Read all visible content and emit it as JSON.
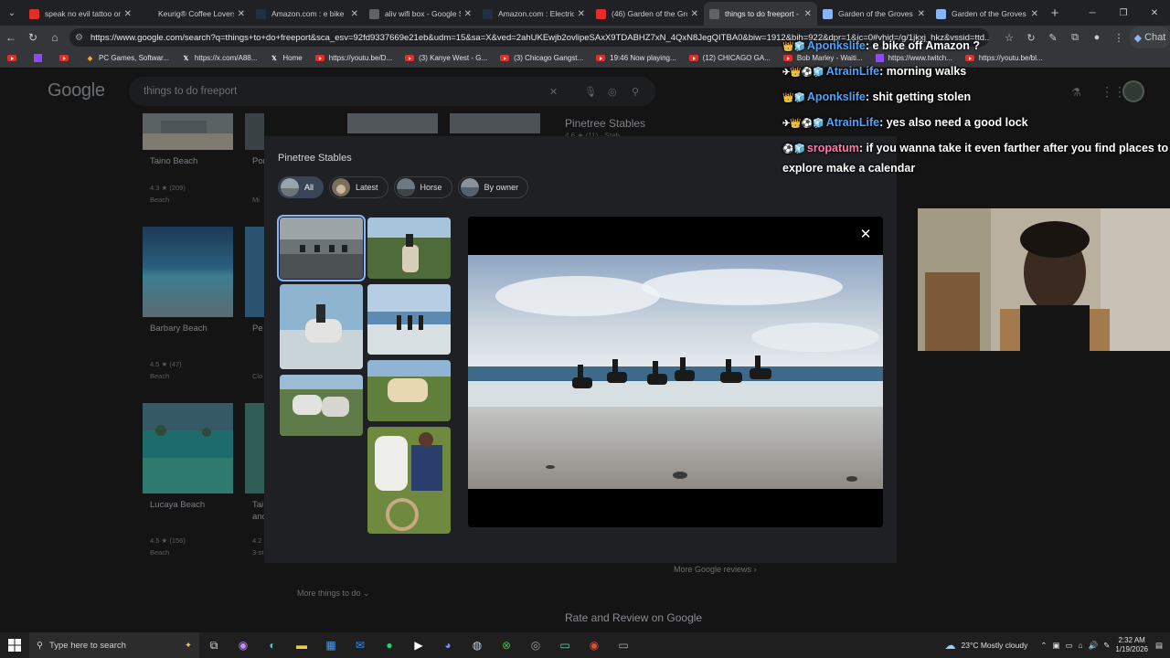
{
  "browser": {
    "tabs": [
      {
        "title": "speak no evil tattoo on",
        "favicon": "youtube-icon",
        "color": "#e52d27"
      },
      {
        "title": "Keurig® Coffee Lovers'",
        "favicon": "keurig-icon",
        "color": "#202124"
      },
      {
        "title": "Amazon.com : e bike",
        "favicon": "amazon-icon",
        "color": "#232f3e"
      },
      {
        "title": "aliv wifi box - Google Se",
        "favicon": "google-icon",
        "color": "#5f6368"
      },
      {
        "title": "Amazon.com : Electric Bi",
        "favicon": "amazon-icon",
        "color": "#232f3e"
      },
      {
        "title": "(46) Garden of the Grov",
        "favicon": "youtube-icon",
        "color": "#e52d27"
      },
      {
        "title": "things to do freeport - G",
        "favicon": "google-icon",
        "color": "#5f6368",
        "active": true
      },
      {
        "title": "Garden of the Groves - G",
        "favicon": "search-icon",
        "color": "#8ab4f8"
      },
      {
        "title": "Garden of the Groves - G",
        "favicon": "search-icon",
        "color": "#8ab4f8"
      }
    ],
    "url": "https://www.google.com/search?q=things+to+do+freeport&sca_esv=92fd9337669e21eb&udm=15&sa=X&ved=2ahUKEwjb2ovlipeSAxX9TDABHZ7xN_4QxN8JegQITBA0&biw=1912&bih=922&dpr=1&ic=0#vhid=/g/1jkxj_hkz&vssid=ttd...",
    "chat_button": "Chat",
    "bookmarks": [
      {
        "label": "",
        "icon": "youtube-icon"
      },
      {
        "label": "",
        "icon": "twitch-icon"
      },
      {
        "label": "",
        "icon": "youtube-icon"
      },
      {
        "label": "PC Games, Softwar...",
        "icon": "game-icon"
      },
      {
        "label": "https://x.com/A88...",
        "icon": "x-icon"
      },
      {
        "label": "Home",
        "icon": "x-icon"
      },
      {
        "label": "https://youtu.be/D...",
        "icon": "youtube-icon"
      },
      {
        "label": "(3) Kanye West - G...",
        "icon": "youtube-icon"
      },
      {
        "label": "(3) Chicago Gangst...",
        "icon": "youtube-icon"
      },
      {
        "label": "19:46 Now playing...",
        "icon": "youtube-icon"
      },
      {
        "label": "(12) CHICAGO GA...",
        "icon": "youtube-icon"
      },
      {
        "label": "Bob Marley - Waiti...",
        "icon": "youtube-icon"
      },
      {
        "label": "https://www.twitch...",
        "icon": "twitch-icon"
      },
      {
        "label": "https://youtu.be/bl...",
        "icon": "youtube-icon"
      }
    ]
  },
  "google": {
    "logo": "Google",
    "query": "things to do freeport",
    "cards": [
      {
        "name": "Taino Beach",
        "rating": "4.3 ★ (209)",
        "category": "Beach"
      },
      {
        "name": "Barbary Beach",
        "rating": "4.5 ★ (47)",
        "category": "Beach"
      },
      {
        "name": "Lucaya Beach",
        "rating": "4.5 ★ (156)",
        "category": "Beach"
      }
    ],
    "partial_cards": [
      {
        "name": "Por",
        "rating": "",
        "category": "Mi"
      },
      {
        "name": "Pe",
        "rating": "",
        "category": "Clo"
      },
      {
        "name": "Tai",
        "sub": "and",
        "rating": "4.2",
        "category": "3-st"
      }
    ],
    "side_title": "Pinetree Stables",
    "side_rating": "4.6 ★ (11) · Stab",
    "more_reviews": "More Google reviews",
    "more_things": "More things to do",
    "rate_review": "Rate and Review on Google"
  },
  "overlay": {
    "title": "Pinetree Stables",
    "chips": [
      {
        "label": "All",
        "selected": true
      },
      {
        "label": "Latest",
        "selected": false
      },
      {
        "label": "Horse",
        "selected": false
      },
      {
        "label": "By owner",
        "selected": false
      }
    ],
    "close_label": "✕"
  },
  "chat": [
    {
      "badges": "👑🧊",
      "user": "Aponkslife",
      "color": "#4da3ff",
      "text": "e bike off Amazon ?"
    },
    {
      "badges": "✈👑⚽🧊",
      "user": "AtrainLife",
      "color": "#4da3ff",
      "text": "morning walks"
    },
    {
      "badges": "👑🧊",
      "user": "Aponkslife",
      "color": "#4da3ff",
      "text": "shit getting stolen"
    },
    {
      "badges": "✈👑⚽🧊",
      "user": "AtrainLife",
      "color": "#4da3ff",
      "text": "yes also need a good lock"
    },
    {
      "badges": "⚽🧊",
      "user": "sropatum",
      "color": "#ff7ba9",
      "text": "if you wanna take it even farther after you find places to explore make a calendar"
    }
  ],
  "taskbar": {
    "search_placeholder": "Type here to search",
    "weather": "23°C  Mostly cloudy",
    "time": "2:32 AM",
    "date": "1/19/2026"
  }
}
